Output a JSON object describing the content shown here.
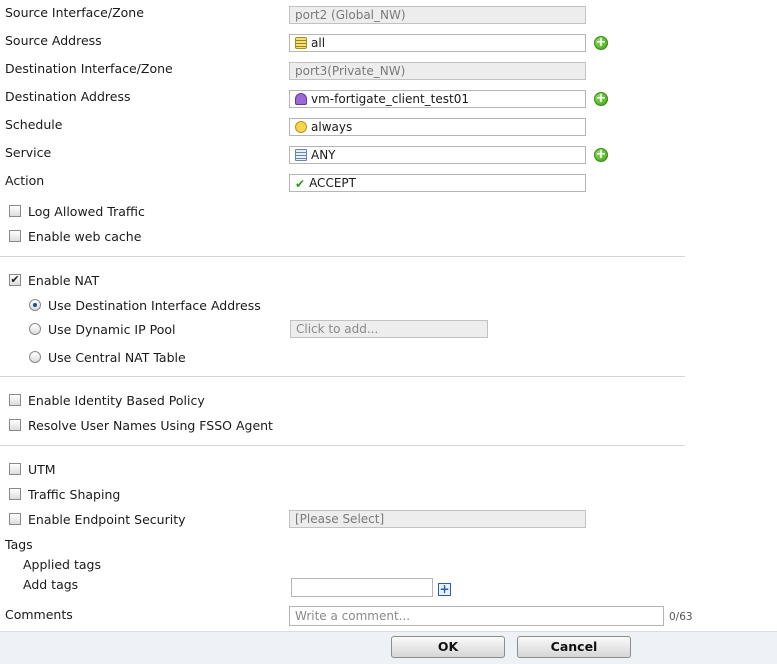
{
  "form": {
    "source_interface": {
      "label": "Source Interface/Zone",
      "value": "port2 (Global_NW)"
    },
    "source_address": {
      "label": "Source Address",
      "value": "all"
    },
    "destination_interface": {
      "label": "Destination Interface/Zone",
      "value": "port3(Private_NW)"
    },
    "destination_address": {
      "label": "Destination Address",
      "value": "vm-fortigate_client_test01"
    },
    "schedule": {
      "label": "Schedule",
      "value": "always"
    },
    "service": {
      "label": "Service",
      "value": "ANY"
    },
    "action": {
      "label": "Action",
      "value": "ACCEPT"
    }
  },
  "options": {
    "log_allowed_traffic": {
      "label": "Log Allowed Traffic",
      "checked": false
    },
    "enable_web_cache": {
      "label": "Enable web cache",
      "checked": false
    },
    "enable_nat": {
      "label": "Enable NAT",
      "checked": true
    },
    "nat_radios": [
      {
        "label": "Use Destination Interface Address",
        "selected": true
      },
      {
        "label": "Use Dynamic IP Pool",
        "selected": false
      },
      {
        "label": "Use Central NAT Table",
        "selected": false
      }
    ],
    "ip_pool_placeholder": "Click to add...",
    "identity_policy": {
      "label": "Enable Identity Based Policy",
      "checked": false
    },
    "fsso": {
      "label": "Resolve User Names Using FSSO Agent",
      "checked": false
    },
    "utm": {
      "label": "UTM",
      "checked": false
    },
    "traffic_shaping": {
      "label": "Traffic Shaping",
      "checked": false
    },
    "endpoint_security": {
      "label": "Enable Endpoint Security",
      "checked": false
    },
    "endpoint_select_value": "[Please Select]"
  },
  "tags": {
    "label": "Tags",
    "applied_label": "Applied tags",
    "add_label": "Add tags",
    "add_input_value": ""
  },
  "comments": {
    "label": "Comments",
    "placeholder": "Write a comment...",
    "counter": "0/63"
  },
  "buttons": {
    "ok": "OK",
    "cancel": "Cancel"
  },
  "colors": {
    "add_icon": "#3f9a14",
    "check": "#2f9a1a",
    "tag_plus": "#2a5db0"
  }
}
